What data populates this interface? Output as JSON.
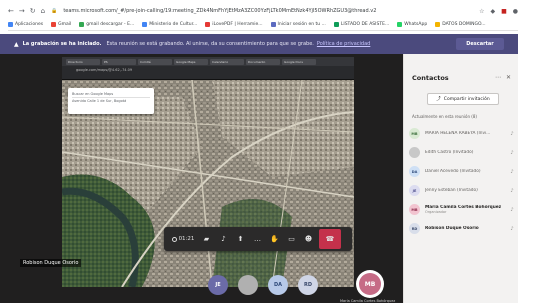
{
  "browser": {
    "url": "teams.microsoft.com/_#/pre-join-calling/19:meeting_ZDk4NmFhYjEtMzA3ZC00YzFjLTk0MmEtNzk4YjI5OWRhZGU3@thread.v2",
    "bookmarks": [
      {
        "label": "Aplicaciones",
        "color": "#4285f4"
      },
      {
        "label": "Gmail",
        "color": "#ea4335"
      },
      {
        "label": "gmail descargar - E...",
        "color": "#34a853"
      },
      {
        "label": "Ministerio de Cultur...",
        "color": "#4285f4"
      },
      {
        "label": "iLovePDF | Herramie...",
        "color": "#e53935"
      },
      {
        "label": "Iniciar sesión en tu ...",
        "color": "#5c6bc0"
      },
      {
        "label": "LISTADO DE ASISTE...",
        "color": "#0f9d58"
      },
      {
        "label": "WhatsApp",
        "color": "#25d366"
      },
      {
        "label": "DATOS DOMINGO...",
        "color": "#f4b400"
      }
    ]
  },
  "banner": {
    "title": "La grabación se ha iniciado.",
    "message": "Esta reunión se está grabando. Al unirse, da su consentimiento para que se grabe.",
    "link": "Política de privacidad",
    "dismiss": "Descartar"
  },
  "shared_screen": {
    "tabs": [
      "Directorio",
      "PS",
      "Comité",
      "Google Maps",
      "Calendario",
      "Documento",
      "Google Docs"
    ],
    "address": "google.com/maps/@4.62,-74.09",
    "search_query": "Buscar en Google Maps",
    "search_suggestion": "Avenida Calle 1 de Sur, Bogotá"
  },
  "call": {
    "timer": "01:21",
    "presenter_name": "Robison Duque Osorio"
  },
  "stage_avatars": [
    {
      "initials": "JE",
      "bg": "#6b6ba8",
      "fg": "#ffffff"
    },
    {
      "initials": "",
      "bg": "#b0b0b0",
      "fg": "#ffffff"
    },
    {
      "initials": "DA",
      "bg": "#b7c9e8",
      "fg": "#2f4a7a"
    },
    {
      "initials": "RD",
      "bg": "#cfd5e6",
      "fg": "#3b4a6b"
    }
  ],
  "self_avatar": {
    "initials": "MB",
    "name": "María Camila Cortes Bohórquez"
  },
  "contacts": {
    "title": "Contactos",
    "share_label": "Compartir invitación",
    "section_label": "Actualmente en esta reunión (8)",
    "people": [
      {
        "initials": "MB",
        "name": "MARIA HELENA RABEYA (Invi...",
        "role": "",
        "bg": "#d9ead3",
        "fg": "#3c6e3c",
        "bold": false
      },
      {
        "initials": "",
        "name": "Edith Castro (Invitado)",
        "role": "",
        "bg": "#c8c8c8",
        "fg": "#ffffff",
        "bold": false
      },
      {
        "initials": "DA",
        "name": "Daniel Acevedo (Invitado)",
        "role": "",
        "bg": "#cfe0f5",
        "fg": "#2f4a7a",
        "bold": false
      },
      {
        "initials": "JE",
        "name": "Jenny Esteban (Invitado)",
        "role": "",
        "bg": "#dcdcf0",
        "fg": "#4a4a8a",
        "bold": false
      },
      {
        "initials": "MB",
        "name": "María Camila Cortes Bohórquez",
        "role": "Organizador",
        "bg": "#f2c4d0",
        "fg": "#8c2a4a",
        "bold": true
      },
      {
        "initials": "RD",
        "name": "Robison Duque Osorio",
        "role": "",
        "bg": "#d8deea",
        "fg": "#3b4a6b",
        "bold": true
      }
    ]
  }
}
